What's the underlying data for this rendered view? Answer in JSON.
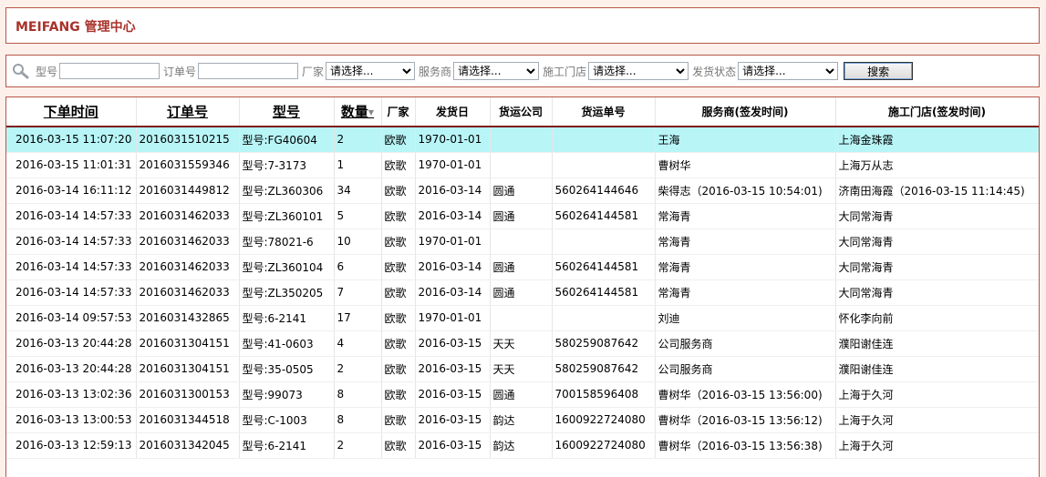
{
  "app": {
    "title": "MEIFANG 管理中心"
  },
  "search": {
    "model_label": "型号",
    "order_label": "订单号",
    "factory_label": "厂家",
    "factory_value": "请选择...",
    "service_label": "服务商",
    "service_value": "请选择...",
    "store_label": "施工门店",
    "store_value": "请选择...",
    "status_label": "发货状态",
    "status_value": "请选择...",
    "button_label": "搜索"
  },
  "table": {
    "headers": {
      "order_time": "下单时间",
      "order_no": "订单号",
      "model": "型号",
      "qty": "数量",
      "factory": "厂家",
      "ship_date": "发货日",
      "carrier": "货运公司",
      "tracking": "货运单号",
      "service": "服务商(签发时间)",
      "store": "施工门店(签发时间)"
    },
    "rows": [
      {
        "time": "2016-03-15 11:07:20",
        "order": "2016031510215",
        "model": "型号:FG40604",
        "qty": "2",
        "factory": "欧歌",
        "ship": "1970-01-01",
        "carrier": "",
        "tracking": "",
        "service": "王海",
        "store": "上海金珠霞"
      },
      {
        "time": "2016-03-15 11:01:31",
        "order": "2016031559346",
        "model": "型号:7-3173",
        "qty": "1",
        "factory": "欧歌",
        "ship": "1970-01-01",
        "carrier": "",
        "tracking": "",
        "service": "曹树华",
        "store": "上海万从志"
      },
      {
        "time": "2016-03-14 16:11:12",
        "order": "2016031449812",
        "model": "型号:ZL360306",
        "qty": "34",
        "factory": "欧歌",
        "ship": "2016-03-14",
        "carrier": "圆通",
        "tracking": "560264144646",
        "service": "柴得志（2016-03-15 10:54:01)",
        "store": "济南田海霞（2016-03-15 11:14:45)"
      },
      {
        "time": "2016-03-14 14:57:33",
        "order": "2016031462033",
        "model": "型号:ZL360101",
        "qty": "5",
        "factory": "欧歌",
        "ship": "2016-03-14",
        "carrier": "圆通",
        "tracking": "560264144581",
        "service": "常海青",
        "store": "大同常海青"
      },
      {
        "time": "2016-03-14 14:57:33",
        "order": "2016031462033",
        "model": "型号:78021-6",
        "qty": "10",
        "factory": "欧歌",
        "ship": "1970-01-01",
        "carrier": "",
        "tracking": "",
        "service": "常海青",
        "store": "大同常海青"
      },
      {
        "time": "2016-03-14 14:57:33",
        "order": "2016031462033",
        "model": "型号:ZL360104",
        "qty": "6",
        "factory": "欧歌",
        "ship": "2016-03-14",
        "carrier": "圆通",
        "tracking": "560264144581",
        "service": "常海青",
        "store": "大同常海青"
      },
      {
        "time": "2016-03-14 14:57:33",
        "order": "2016031462033",
        "model": "型号:ZL350205",
        "qty": "7",
        "factory": "欧歌",
        "ship": "2016-03-14",
        "carrier": "圆通",
        "tracking": "560264144581",
        "service": "常海青",
        "store": "大同常海青"
      },
      {
        "time": "2016-03-14 09:57:53",
        "order": "2016031432865",
        "model": "型号:6-2141",
        "qty": "17",
        "factory": "欧歌",
        "ship": "1970-01-01",
        "carrier": "",
        "tracking": "",
        "service": "刘迪",
        "store": "怀化李向前"
      },
      {
        "time": "2016-03-13 20:44:28",
        "order": "2016031304151",
        "model": "型号:41-0603",
        "qty": "4",
        "factory": "欧歌",
        "ship": "2016-03-15",
        "carrier": "天天",
        "tracking": "580259087642",
        "service": "公司服务商",
        "store": "濮阳谢佳连"
      },
      {
        "time": "2016-03-13 20:44:28",
        "order": "2016031304151",
        "model": "型号:35-0505",
        "qty": "2",
        "factory": "欧歌",
        "ship": "2016-03-15",
        "carrier": "天天",
        "tracking": "580259087642",
        "service": "公司服务商",
        "store": "濮阳谢佳连"
      },
      {
        "time": "2016-03-13 13:02:36",
        "order": "2016031300153",
        "model": "型号:99073",
        "qty": "8",
        "factory": "欧歌",
        "ship": "2016-03-15",
        "carrier": "圆通",
        "tracking": "700158596408",
        "service": "曹树华（2016-03-15 13:56:00)",
        "store": "上海于久河"
      },
      {
        "time": "2016-03-13 13:00:53",
        "order": "2016031344518",
        "model": "型号:C-1003",
        "qty": "8",
        "factory": "欧歌",
        "ship": "2016-03-15",
        "carrier": "韵达",
        "tracking": "1600922724080",
        "service": "曹树华（2016-03-15 13:56:12)",
        "store": "上海于久河"
      },
      {
        "time": "2016-03-13 12:59:13",
        "order": "2016031342045",
        "model": "型号:6-2141",
        "qty": "2",
        "factory": "欧歌",
        "ship": "2016-03-15",
        "carrier": "韵达",
        "tracking": "1600922724080",
        "service": "曹树华（2016-03-15 13:56:38)",
        "store": "上海于久河"
      }
    ]
  }
}
